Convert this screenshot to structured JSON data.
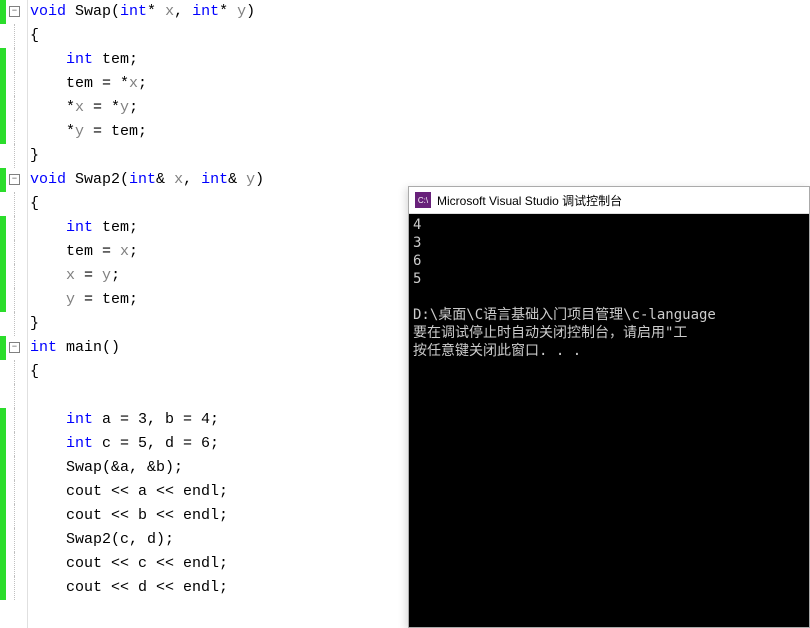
{
  "code": {
    "lines": [
      {
        "fold": "minus",
        "gb": true,
        "tokens": [
          {
            "c": "kw",
            "t": "void"
          },
          {
            "c": "",
            "t": " Swap("
          },
          {
            "c": "kw",
            "t": "int"
          },
          {
            "c": "",
            "t": "* "
          },
          {
            "c": "gray",
            "t": "x"
          },
          {
            "c": "",
            "t": ", "
          },
          {
            "c": "kw",
            "t": "int"
          },
          {
            "c": "",
            "t": "* "
          },
          {
            "c": "gray",
            "t": "y"
          },
          {
            "c": "",
            "t": ")"
          }
        ]
      },
      {
        "fold": "line",
        "gb": false,
        "tokens": [
          {
            "c": "",
            "t": "{"
          }
        ]
      },
      {
        "fold": "line",
        "gb": true,
        "tokens": [
          {
            "c": "",
            "t": "    "
          },
          {
            "c": "kw",
            "t": "int"
          },
          {
            "c": "",
            "t": " tem;"
          }
        ]
      },
      {
        "fold": "line",
        "gb": true,
        "tokens": [
          {
            "c": "",
            "t": "    tem = *"
          },
          {
            "c": "gray",
            "t": "x"
          },
          {
            "c": "",
            "t": ";"
          }
        ]
      },
      {
        "fold": "line",
        "gb": true,
        "tokens": [
          {
            "c": "",
            "t": "    *"
          },
          {
            "c": "gray",
            "t": "x"
          },
          {
            "c": "",
            "t": " = *"
          },
          {
            "c": "gray",
            "t": "y"
          },
          {
            "c": "",
            "t": ";"
          }
        ]
      },
      {
        "fold": "line",
        "gb": true,
        "tokens": [
          {
            "c": "",
            "t": "    *"
          },
          {
            "c": "gray",
            "t": "y"
          },
          {
            "c": "",
            "t": " = tem;"
          }
        ]
      },
      {
        "fold": "line",
        "gb": false,
        "tokens": [
          {
            "c": "",
            "t": "}"
          }
        ]
      },
      {
        "fold": "minus",
        "gb": true,
        "tokens": [
          {
            "c": "kw",
            "t": "void"
          },
          {
            "c": "",
            "t": " Swap2("
          },
          {
            "c": "kw",
            "t": "int"
          },
          {
            "c": "",
            "t": "& "
          },
          {
            "c": "gray",
            "t": "x"
          },
          {
            "c": "",
            "t": ", "
          },
          {
            "c": "kw",
            "t": "int"
          },
          {
            "c": "",
            "t": "& "
          },
          {
            "c": "gray",
            "t": "y"
          },
          {
            "c": "",
            "t": ")"
          }
        ]
      },
      {
        "fold": "line",
        "gb": false,
        "tokens": [
          {
            "c": "",
            "t": "{"
          }
        ]
      },
      {
        "fold": "line",
        "gb": true,
        "tokens": [
          {
            "c": "",
            "t": "    "
          },
          {
            "c": "kw",
            "t": "int"
          },
          {
            "c": "",
            "t": " tem;"
          }
        ]
      },
      {
        "fold": "line",
        "gb": true,
        "tokens": [
          {
            "c": "",
            "t": "    tem = "
          },
          {
            "c": "gray",
            "t": "x"
          },
          {
            "c": "",
            "t": ";"
          }
        ]
      },
      {
        "fold": "line",
        "gb": true,
        "tokens": [
          {
            "c": "",
            "t": "    "
          },
          {
            "c": "gray",
            "t": "x"
          },
          {
            "c": "",
            "t": " = "
          },
          {
            "c": "gray",
            "t": "y"
          },
          {
            "c": "",
            "t": ";"
          }
        ]
      },
      {
        "fold": "line",
        "gb": true,
        "tokens": [
          {
            "c": "",
            "t": "    "
          },
          {
            "c": "gray",
            "t": "y"
          },
          {
            "c": "",
            "t": " = tem;"
          }
        ]
      },
      {
        "fold": "line",
        "gb": false,
        "tokens": [
          {
            "c": "",
            "t": "}"
          }
        ]
      },
      {
        "fold": "minus",
        "gb": true,
        "tokens": [
          {
            "c": "kw",
            "t": "int"
          },
          {
            "c": "",
            "t": " main()"
          }
        ]
      },
      {
        "fold": "line",
        "gb": false,
        "tokens": [
          {
            "c": "",
            "t": "{"
          }
        ]
      },
      {
        "fold": "line",
        "gb": false,
        "tokens": [
          {
            "c": "",
            "t": ""
          }
        ]
      },
      {
        "fold": "line",
        "gb": true,
        "tokens": [
          {
            "c": "",
            "t": "    "
          },
          {
            "c": "kw",
            "t": "int"
          },
          {
            "c": "",
            "t": " a = 3, b = 4;"
          }
        ]
      },
      {
        "fold": "line",
        "gb": true,
        "tokens": [
          {
            "c": "",
            "t": "    "
          },
          {
            "c": "kw",
            "t": "int"
          },
          {
            "c": "",
            "t": " c = 5, d = 6;"
          }
        ]
      },
      {
        "fold": "line",
        "gb": true,
        "tokens": [
          {
            "c": "",
            "t": "    Swap(&a, &b);"
          }
        ]
      },
      {
        "fold": "line",
        "gb": true,
        "tokens": [
          {
            "c": "",
            "t": "    cout << a << endl;"
          }
        ]
      },
      {
        "fold": "line",
        "gb": true,
        "tokens": [
          {
            "c": "",
            "t": "    cout << b << endl;"
          }
        ]
      },
      {
        "fold": "line",
        "gb": true,
        "tokens": [
          {
            "c": "",
            "t": "    Swap2(c, d);"
          }
        ]
      },
      {
        "fold": "line",
        "gb": true,
        "tokens": [
          {
            "c": "",
            "t": "    cout << c << endl;"
          }
        ]
      },
      {
        "fold": "line",
        "gb": true,
        "tokens": [
          {
            "c": "",
            "t": "    cout << d << endl;"
          }
        ]
      }
    ]
  },
  "console": {
    "icon_text": "C:\\",
    "title": "Microsoft Visual Studio 调试控制台",
    "output": "4\n3\n6\n5\n\nD:\\桌面\\C语言基础入门项目管理\\c-language\n要在调试停止时自动关闭控制台，请启用\"工\n按任意键关闭此窗口. . ."
  }
}
